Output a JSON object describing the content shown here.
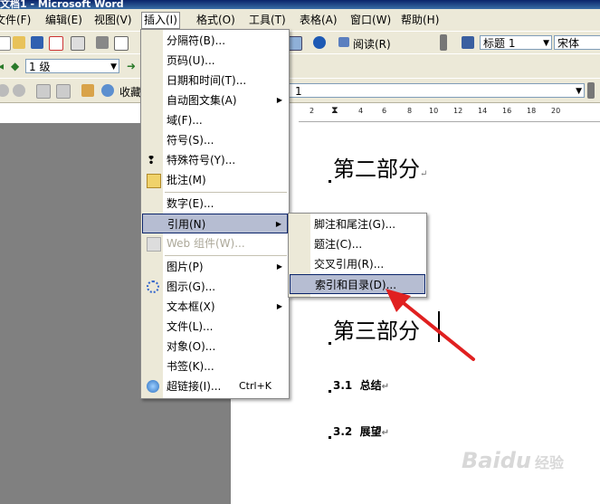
{
  "window": {
    "title": "文档1 - Microsoft Word"
  },
  "menubar": [
    {
      "label": "文件(F)"
    },
    {
      "label": "编辑(E)"
    },
    {
      "label": "视图(V)"
    },
    {
      "label": "插入(I)"
    },
    {
      "label": "格式(O)"
    },
    {
      "label": "工具(T)"
    },
    {
      "label": "表格(A)"
    },
    {
      "label": "窗口(W)"
    },
    {
      "label": "帮助(H)"
    }
  ],
  "toolbar": {
    "reading": "阅读(R)",
    "style_value": "标题 1",
    "font_value": "宋体"
  },
  "outline": {
    "level_value": "1 级",
    "favorites": "收藏",
    "second_combo_value": "1"
  },
  "ruler": {
    "ticks": [
      "2",
      "2",
      "4",
      "6",
      "8",
      "10",
      "12",
      "14",
      "16",
      "18",
      "20"
    ]
  },
  "insert_menu": {
    "items": [
      {
        "label": "分隔符(B)..."
      },
      {
        "label": "页码(U)..."
      },
      {
        "label": "日期和时间(T)..."
      },
      {
        "label": "自动图文集(A)"
      },
      {
        "label": "域(F)..."
      },
      {
        "label": "符号(S)..."
      },
      {
        "label": "特殊符号(Y)..."
      },
      {
        "label": "批注(M)"
      },
      {
        "label": "数字(E)..."
      },
      {
        "label": "引用(N)"
      },
      {
        "label": "Web 组件(W)..."
      },
      {
        "label": "图片(P)"
      },
      {
        "label": "图示(G)..."
      },
      {
        "label": "文本框(X)"
      },
      {
        "label": "文件(L)..."
      },
      {
        "label": "对象(O)..."
      },
      {
        "label": "书签(K)..."
      },
      {
        "label": "超链接(I)..."
      }
    ],
    "hyperlink_shortcut": "Ctrl+K"
  },
  "reference_submenu": {
    "items": [
      {
        "label": "脚注和尾注(G)..."
      },
      {
        "label": "题注(C)..."
      },
      {
        "label": "交叉引用(R)..."
      },
      {
        "label": "索引和目录(D)..."
      }
    ]
  },
  "document": {
    "h1a": "第二部分",
    "h1b": "第三部分",
    "h2a_num": "3.1",
    "h2a_text": "总结",
    "h2b_num": "3.2",
    "h2b_text": "展望",
    "para_mark": "↵"
  },
  "watermark": {
    "brand": "Baidu",
    "product": "经验"
  },
  "colors": {
    "menu_bg": "#ece9d8",
    "highlight": "#b6bdd2",
    "arrow": "#e02020",
    "title_bar": "#0a246a"
  }
}
